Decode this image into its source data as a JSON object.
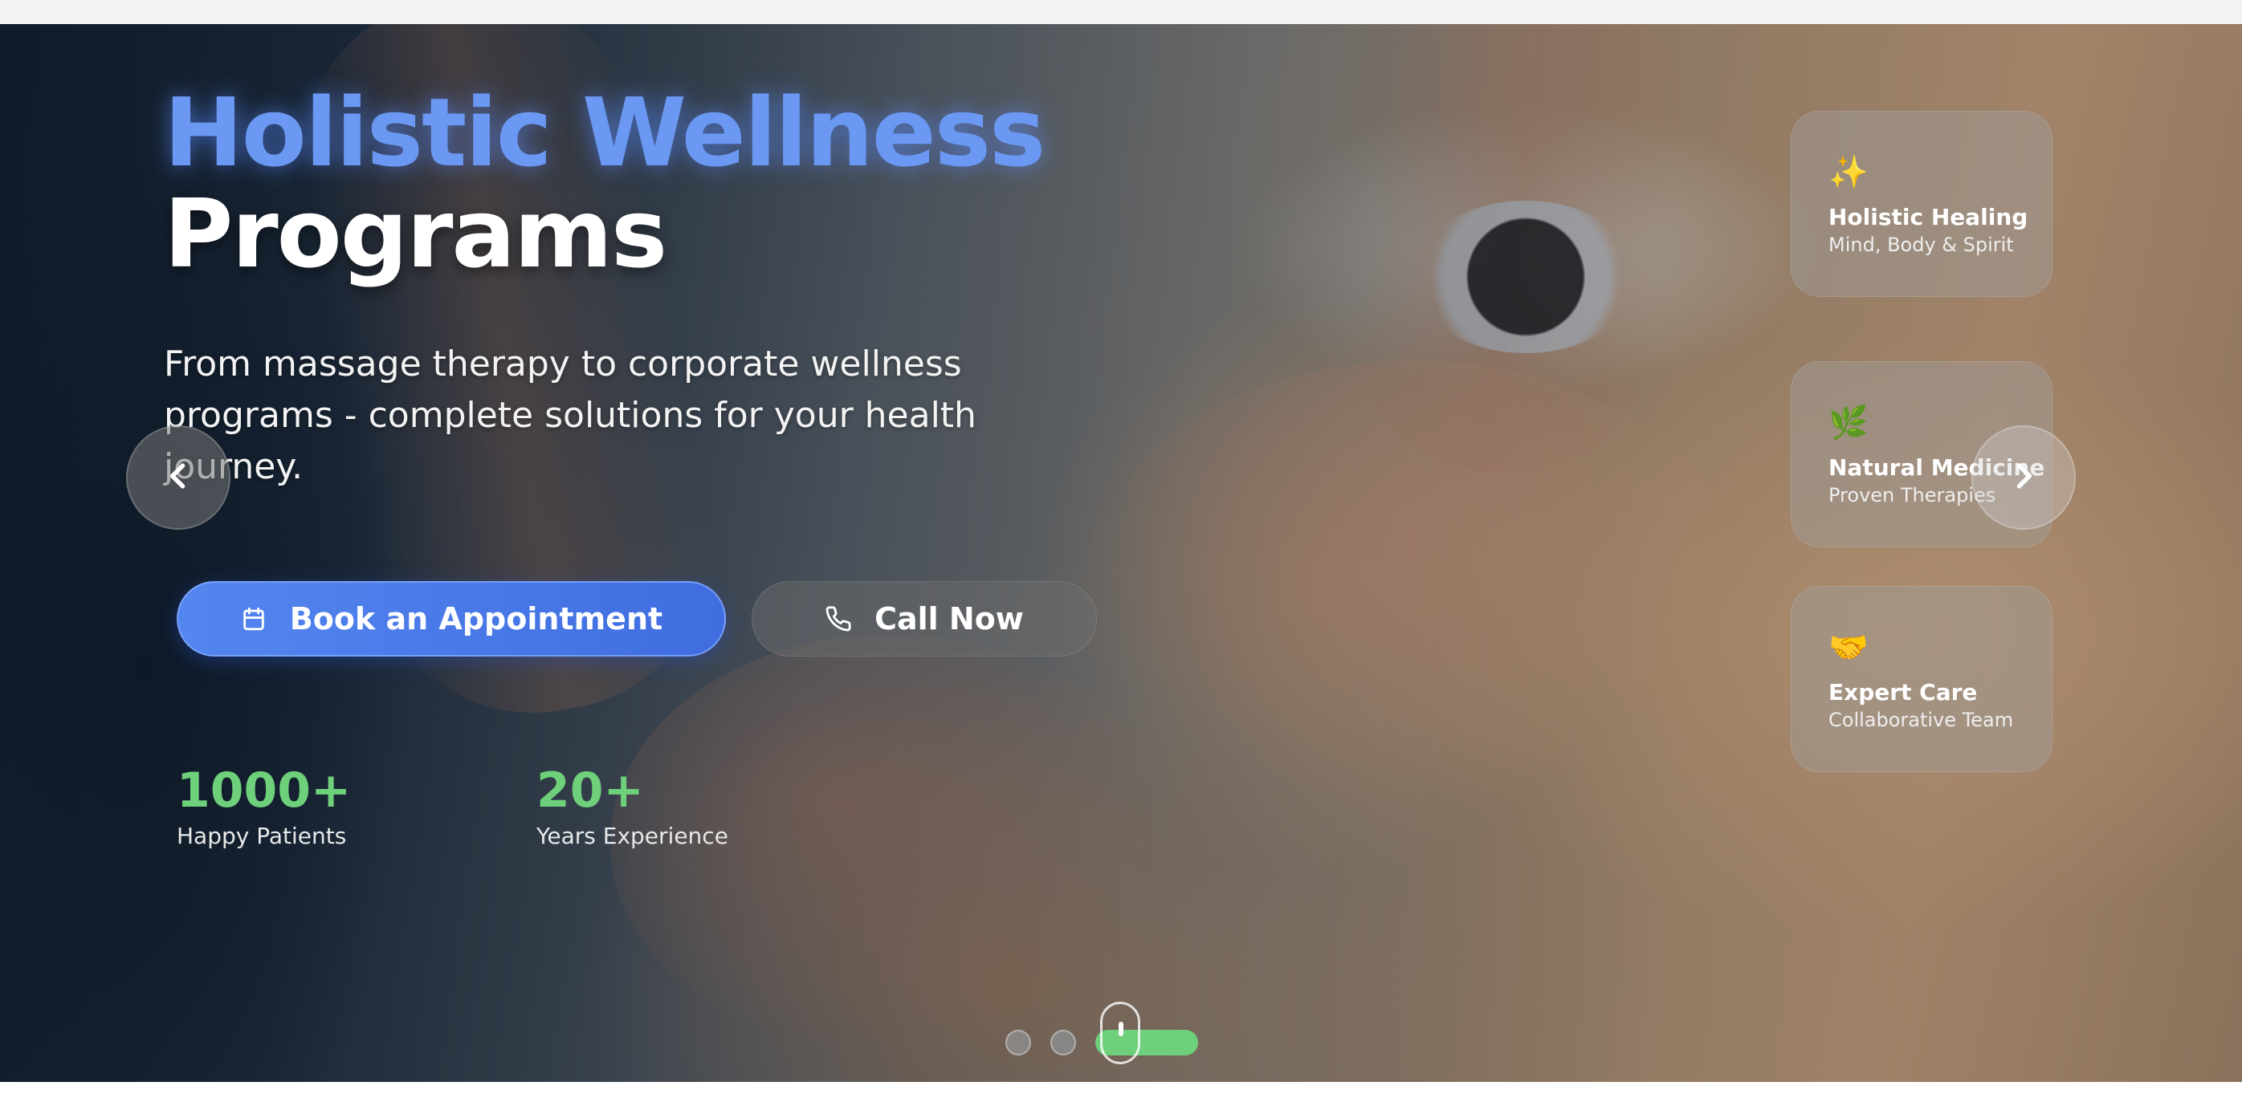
{
  "hero": {
    "headline_accent": "Holistic Wellness",
    "headline_main": "Programs",
    "subtitle": "From massage therapy to corporate wellness programs - complete solutions for your health journey.",
    "primary_button": {
      "label": "Book an Appointment",
      "icon": "calendar-icon"
    },
    "secondary_button": {
      "label": "Call Now",
      "icon": "phone-icon"
    },
    "stats": [
      {
        "value": "1000+",
        "label": "Happy Patients"
      },
      {
        "value": "20+",
        "label": "Years Experience"
      }
    ]
  },
  "feature_cards": [
    {
      "emoji": "✨",
      "icon": "sparkles-icon",
      "title": "Holistic Healing",
      "subtitle": "Mind, Body & Spirit"
    },
    {
      "emoji": "🌿",
      "icon": "herb-icon",
      "title": "Natural Medicine",
      "subtitle": "Proven Therapies"
    },
    {
      "emoji": "🤝",
      "icon": "handshake-icon",
      "title": "Expert Care",
      "subtitle": "Collaborative Team"
    }
  ],
  "carousel": {
    "prev_icon": "chevron-left-icon",
    "next_icon": "chevron-right-icon",
    "slide_count": 3,
    "active_index": 2
  },
  "colors": {
    "accent_blue": "#6b98f2",
    "button_blue": "#4a7ae8",
    "stat_green": "#6ed07a"
  }
}
